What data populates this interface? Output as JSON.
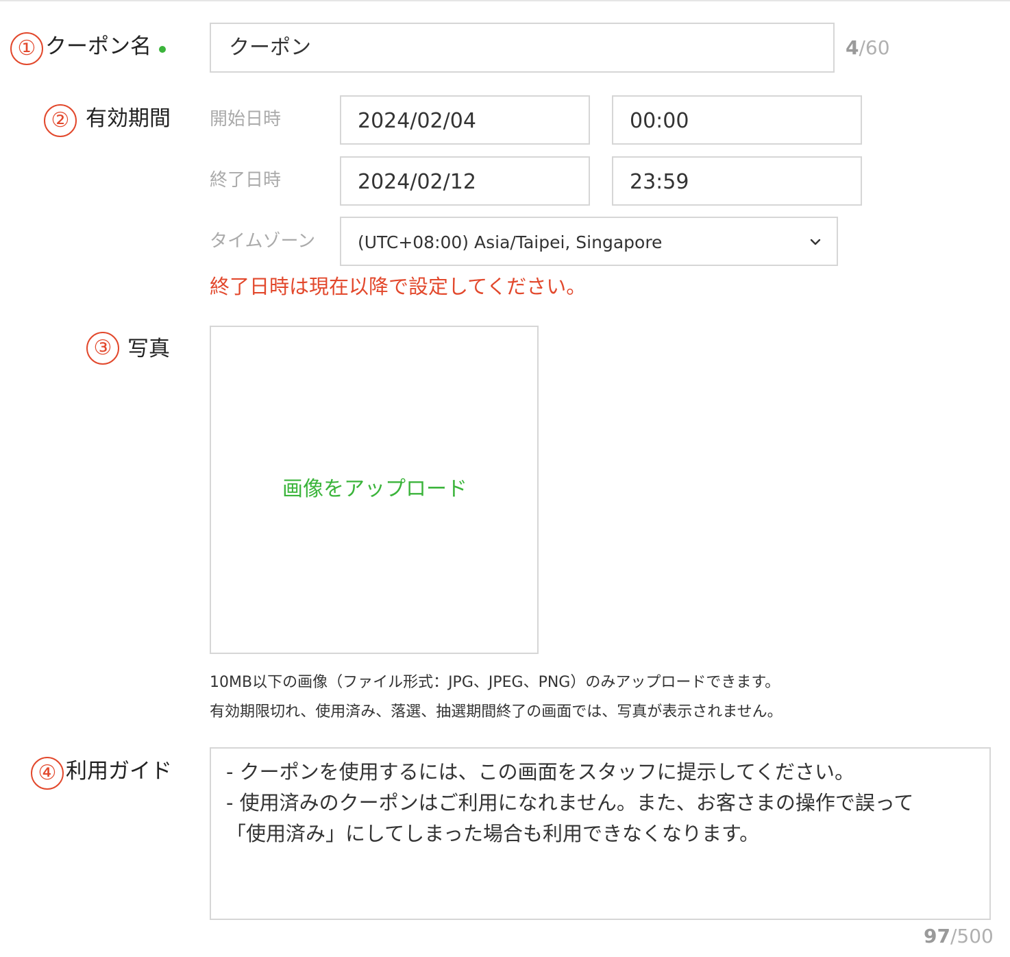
{
  "coupon_name": {
    "step": "①",
    "label": "クーポン名",
    "value": "クーポン",
    "count": "4",
    "max": "/60"
  },
  "validity": {
    "step": "②",
    "label": "有効期間",
    "start_label": "開始日時",
    "start_date": "2024/02/04",
    "start_time": "00:00",
    "end_label": "終了日時",
    "end_date": "2024/02/12",
    "end_time": "23:59",
    "timezone_label": "タイムゾーン",
    "timezone_value": "(UTC+08:00) Asia/Taipei, Singapore",
    "error": "終了日時は現在以降で設定してください。"
  },
  "photo": {
    "step": "③",
    "label": "写真",
    "upload_label": "画像をアップロード",
    "note1": "10MB以下の画像（ファイル形式：JPG、JPEG、PNG）のみアップロードできます。",
    "note2": "有効期限切れ、使用済み、落選、抽選期間終了の画面では、写真が表示されません。"
  },
  "guide": {
    "step": "④",
    "label": "利用ガイド",
    "text": "- クーポンを使用するには、この画面をスタッフに提示してください。\n- 使用済みのクーポンはご利用になれません。また、お客さまの操作で誤って\n「使用済み」にしてしまった場合も利用できなくなります。",
    "count": "97",
    "max": "/500"
  },
  "colors": {
    "accent_green": "#3bb43b",
    "error_red": "#e2482c",
    "border": "#d6d6d6"
  },
  "icons": {
    "timezone_dropdown": "chevron-down-icon",
    "required": "required-dot-icon"
  }
}
